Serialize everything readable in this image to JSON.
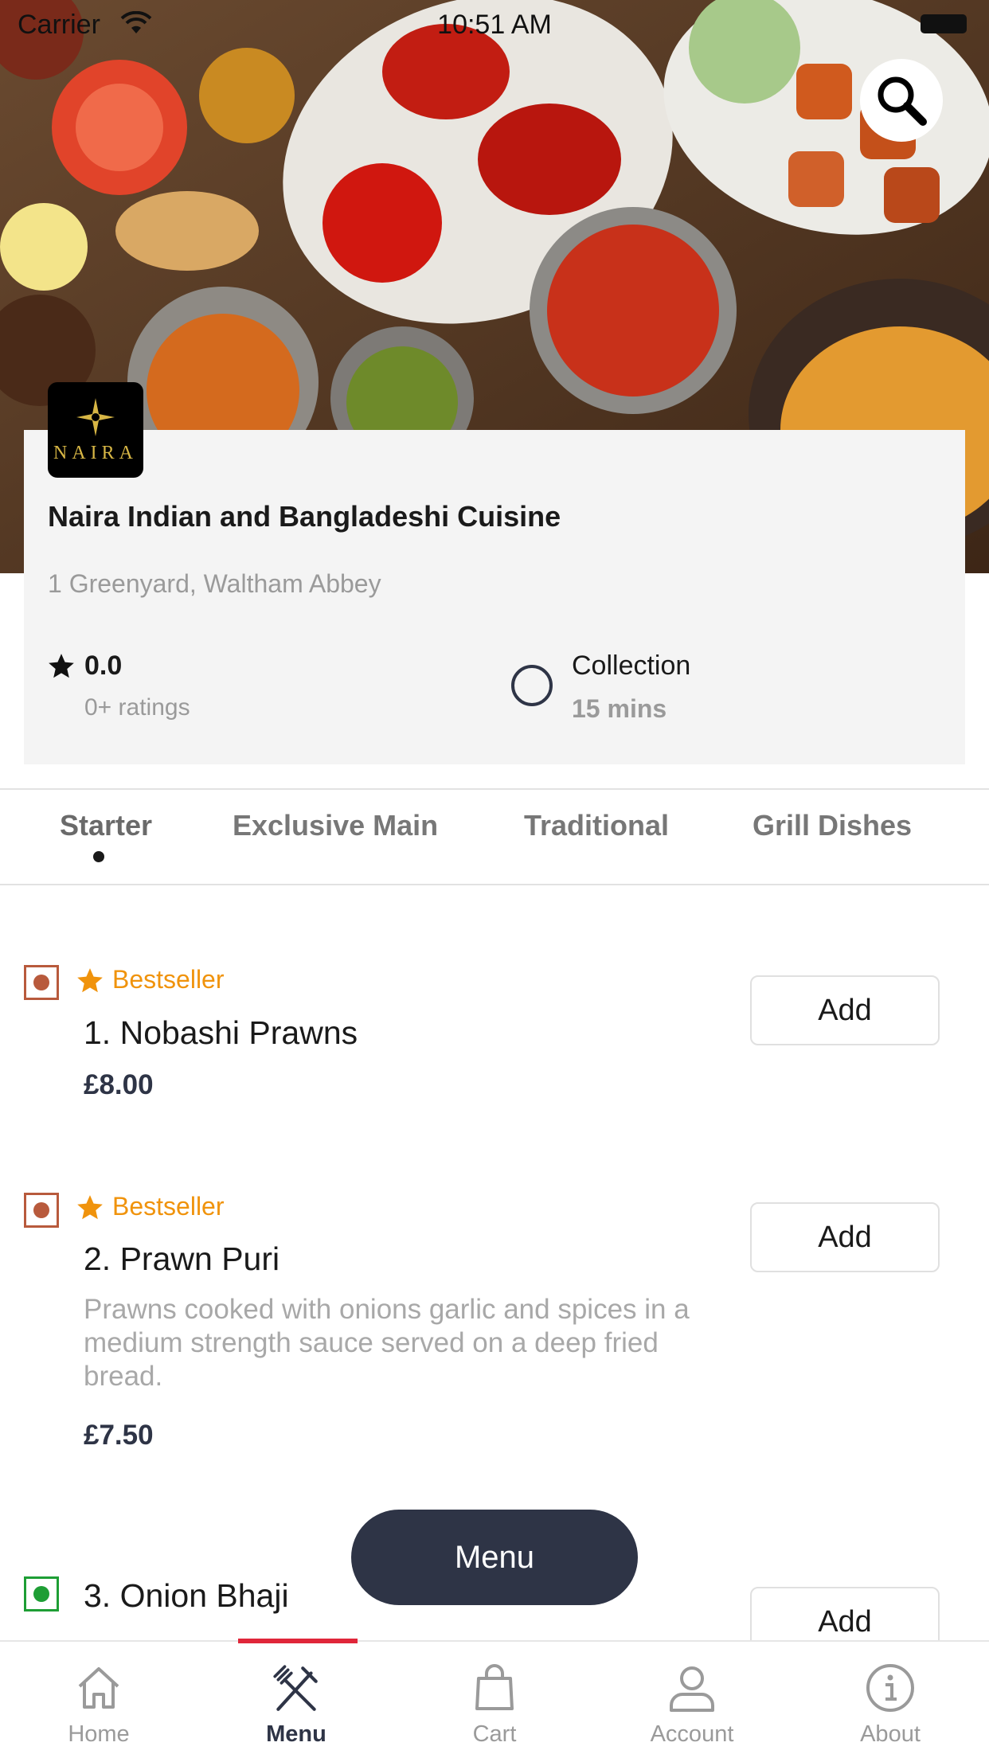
{
  "status_bar": {
    "carrier": "Carrier",
    "time": "10:51 AM"
  },
  "restaurant": {
    "logo_text": "NAIRA",
    "name": "Naira Indian and Bangladeshi Cuisine",
    "address": "1 Greenyard, Waltham Abbey",
    "rating": "0.0",
    "rating_count": "0+ ratings",
    "delivery_mode": "Collection",
    "delivery_time": "15 mins"
  },
  "tabs": [
    {
      "label": "Starter",
      "active": true
    },
    {
      "label": "Exclusive Main",
      "active": false
    },
    {
      "label": "Traditional",
      "active": false
    },
    {
      "label": "Grill Dishes",
      "active": false
    }
  ],
  "items": [
    {
      "badge": "Bestseller",
      "name": "1. Nobashi Prawns",
      "description": "",
      "price": "£8.00",
      "type": "non-veg",
      "add_label": "Add"
    },
    {
      "badge": "Bestseller",
      "name": "2. Prawn Puri",
      "description": "Prawns cooked with onions garlic and spices in a medium strength sauce served on a deep fried bread.",
      "price": "£7.50",
      "type": "non-veg",
      "add_label": "Add"
    },
    {
      "badge": "",
      "name": "3. Onion Bhaji",
      "description": "",
      "price": "",
      "type": "veg",
      "add_label": "Add"
    }
  ],
  "menu_button": "Menu",
  "bottom_nav": [
    {
      "label": "Home",
      "icon": "home-icon",
      "active": false
    },
    {
      "label": "Menu",
      "icon": "fork-knife-icon",
      "active": true
    },
    {
      "label": "Cart",
      "icon": "shopping-bag-icon",
      "active": false
    },
    {
      "label": "Account",
      "icon": "user-icon",
      "active": false
    },
    {
      "label": "About",
      "icon": "info-icon",
      "active": false
    }
  ],
  "colors": {
    "accent_dark": "#2e3446",
    "bestseller": "#f0930c",
    "non_veg": "#b85a3c",
    "veg": "#1e9e35",
    "active_indicator": "#e0263a"
  }
}
